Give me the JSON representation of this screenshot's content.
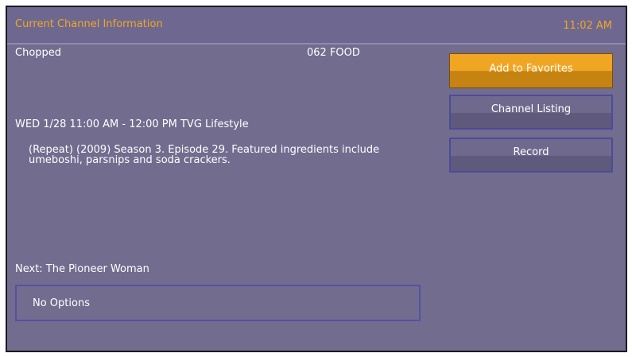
{
  "header": {
    "title": "Current Channel Information",
    "time": "11:02 AM"
  },
  "program": {
    "title": "Chopped",
    "channel": "062 FOOD",
    "airtime": "WED 1/28 11:00 AM - 12:00 PM TVG Lifestyle",
    "description": "(Repeat) (2009) Season 3. Episode 29. Featured ingredients include umeboshi, parsnips and soda crackers.",
    "next": "Next: The Pioneer Woman"
  },
  "options": {
    "label": "No Options"
  },
  "actions": {
    "add_favorites": "Add to Favorites",
    "channel_listing": "Channel Listing",
    "record": "Record"
  },
  "colors": {
    "accent": "#f0a623",
    "panel": "#726c8f",
    "border": "#4d4a9b"
  }
}
